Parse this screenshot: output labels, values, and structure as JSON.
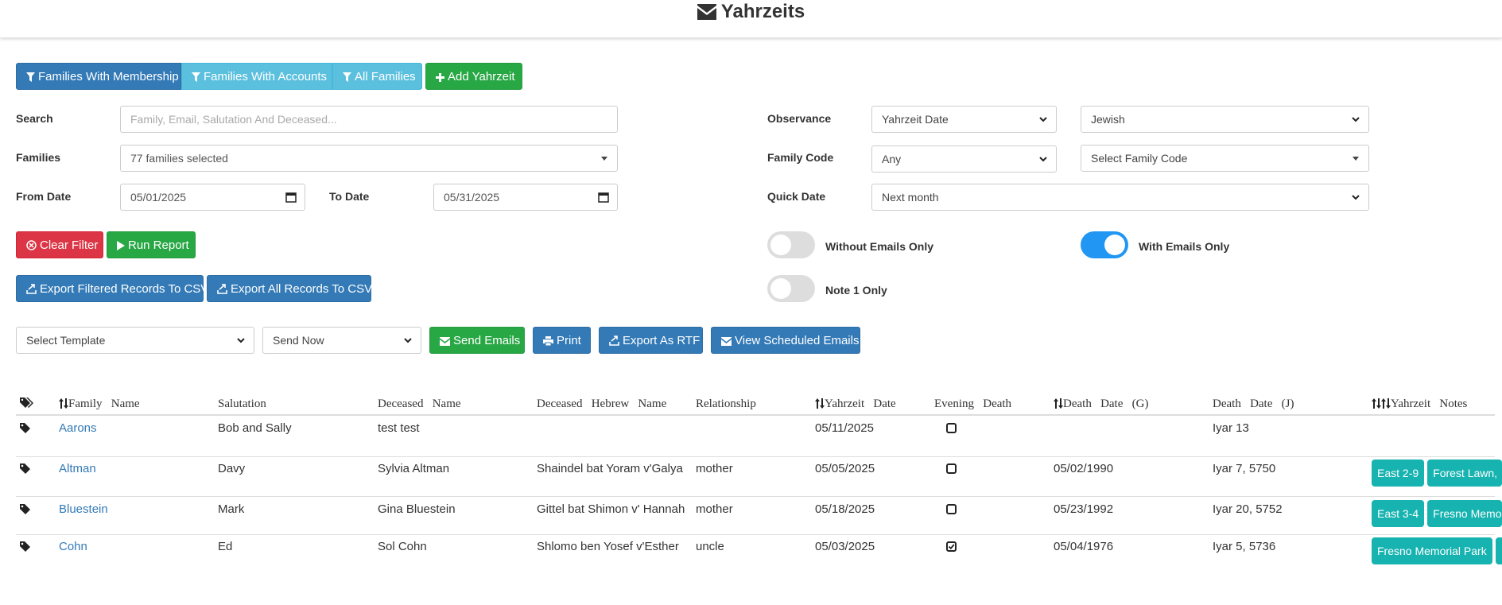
{
  "page": {
    "title": "Yahrzeits",
    "title_icon": "envelope-icon"
  },
  "filter_buttons": {
    "membership": "Families With Membership",
    "accounts": "Families With Accounts",
    "all": "All Families",
    "add": "Add Yahrzeit"
  },
  "form": {
    "search_label": "Search",
    "search_placeholder": "Family, Email, Salutation And Deceased...",
    "families_label": "Families",
    "families_value": "77 families selected",
    "from_date_label": "From Date",
    "from_date_value": "05/01/2025",
    "to_date_label": "To Date",
    "to_date_value": "05/31/2025",
    "observance_label": "Observance",
    "observance_value": "Yahrzeit Date",
    "calendar_value": "Jewish",
    "family_code_label": "Family Code",
    "family_code_value": "Any",
    "family_code_select": "Select Family Code",
    "quick_date_label": "Quick Date",
    "quick_date_value": "Next month"
  },
  "actions": {
    "clear_filter": "Clear Filter",
    "run_report": "Run Report",
    "export_filtered": "Export Filtered Records To CSV",
    "export_all": "Export All Records To CSV"
  },
  "toggles": {
    "without_emails": {
      "label": "Without Emails Only",
      "on": false
    },
    "with_emails": {
      "label": "With Emails Only",
      "on": true
    },
    "note1": {
      "label": "Note 1 Only",
      "on": false
    }
  },
  "email_bar": {
    "template_value": "Select Template",
    "send_value": "Send Now",
    "send_emails": "Send Emails",
    "print": "Print",
    "export_rtf": "Export As RTF",
    "view_scheduled": "View Scheduled Emails"
  },
  "table": {
    "columns": {
      "family": "Family   Name",
      "salutation": "Salutation",
      "deceased": "Deceased   Name",
      "hebrew": "Deceased   Hebrew   Name",
      "relationship": "Relationship",
      "yahrzeit": "Yahrzeit   Date",
      "evening": "Evening   Death",
      "death_g": "Death   Date   (G)",
      "death_j": "Death   Date   (J)",
      "notes": "Yahrzeit   Notes"
    },
    "rows": [
      {
        "family": "Aarons",
        "salutation": "Bob and Sally",
        "deceased": "test test",
        "hebrew": "",
        "relationship": "",
        "yahrzeit": "05/11/2025",
        "evening": false,
        "death_g": "",
        "death_j": "Iyar 13",
        "tags": []
      },
      {
        "family": "Altman",
        "salutation": "Davy",
        "deceased": "Sylvia Altman",
        "hebrew": "Shaindel bat Yoram v'Galya",
        "relationship": "mother",
        "yahrzeit": "05/05/2025",
        "evening": false,
        "death_g": "05/02/1990",
        "death_j": "Iyar 7, 5750",
        "tags": [
          "East 2-9",
          "Forest Lawn,"
        ]
      },
      {
        "family": "Bluestein",
        "salutation": "Mark",
        "deceased": "Gina Bluestein",
        "hebrew": "Gittel bat Shimon v' Hannah",
        "relationship": "mother",
        "yahrzeit": "05/18/2025",
        "evening": false,
        "death_g": "05/23/1992",
        "death_j": "Iyar 20, 5752",
        "tags": [
          "East 3-4",
          "Fresno Memo"
        ]
      },
      {
        "family": "Cohn",
        "salutation": "Ed",
        "deceased": "Sol Cohn",
        "hebrew": "Shlomo ben Yosef v'Esther",
        "relationship": "uncle",
        "yahrzeit": "05/03/2025",
        "evening": true,
        "death_g": "05/04/1976",
        "death_j": "Iyar 5, 5736",
        "tags": [
          "Fresno Memorial Park",
          ""
        ]
      }
    ]
  },
  "colors": {
    "primary": "#337ab7",
    "info": "#5bc0de",
    "success": "#28a745",
    "danger": "#dc3545",
    "tag": "#17b3b0",
    "toggle_on": "#2196f3"
  }
}
